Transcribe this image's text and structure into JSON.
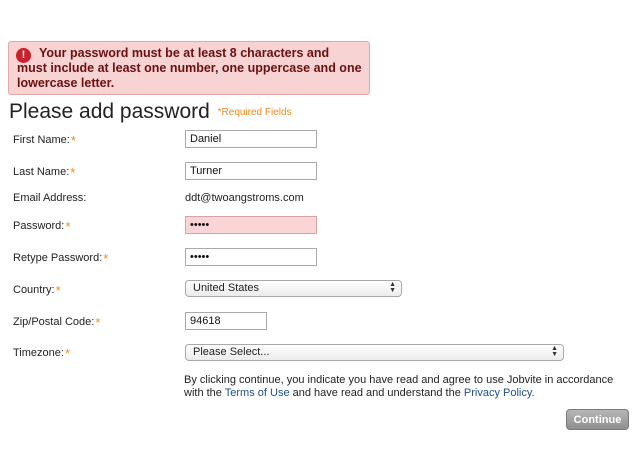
{
  "error": {
    "text": "Your password must be at least 8 characters and must include at least one number, one uppercase and one lowercase letter."
  },
  "header": {
    "title": "Please add password",
    "required_note": "*Required Fields"
  },
  "required_marker": "*",
  "form": {
    "first_name": {
      "label": "First Name:",
      "value": "Daniel"
    },
    "last_name": {
      "label": "Last Name:",
      "value": "Turner"
    },
    "email": {
      "label": "Email Address:",
      "value": "ddt@twoangstroms.com"
    },
    "password": {
      "label": "Password:",
      "value": "•••••"
    },
    "retype_password": {
      "label": "Retype Password:",
      "value": "•••••"
    },
    "country": {
      "label": "Country:",
      "value": "United States"
    },
    "zip": {
      "label": "Zip/Postal Code:",
      "value": "94618"
    },
    "timezone": {
      "label": "Timezone:",
      "value": "Please Select..."
    }
  },
  "disclaimer": {
    "part1": "By clicking continue, you indicate you have read and agree to use Jobvite in accordance with the ",
    "terms_link": "Terms of Use",
    "part2": " and have read and understand the ",
    "privacy_link": "Privacy Policy",
    "part3": "."
  },
  "continue_label": "Continue",
  "icons": {
    "error": "error-icon",
    "select_arrows": "updown-arrows-icon"
  },
  "colors": {
    "error_bg": "#f7d3d3",
    "error_text": "#6a1010",
    "required": "#ef8a1c",
    "link": "#1d4f8a",
    "button": "#9f9f9f"
  }
}
